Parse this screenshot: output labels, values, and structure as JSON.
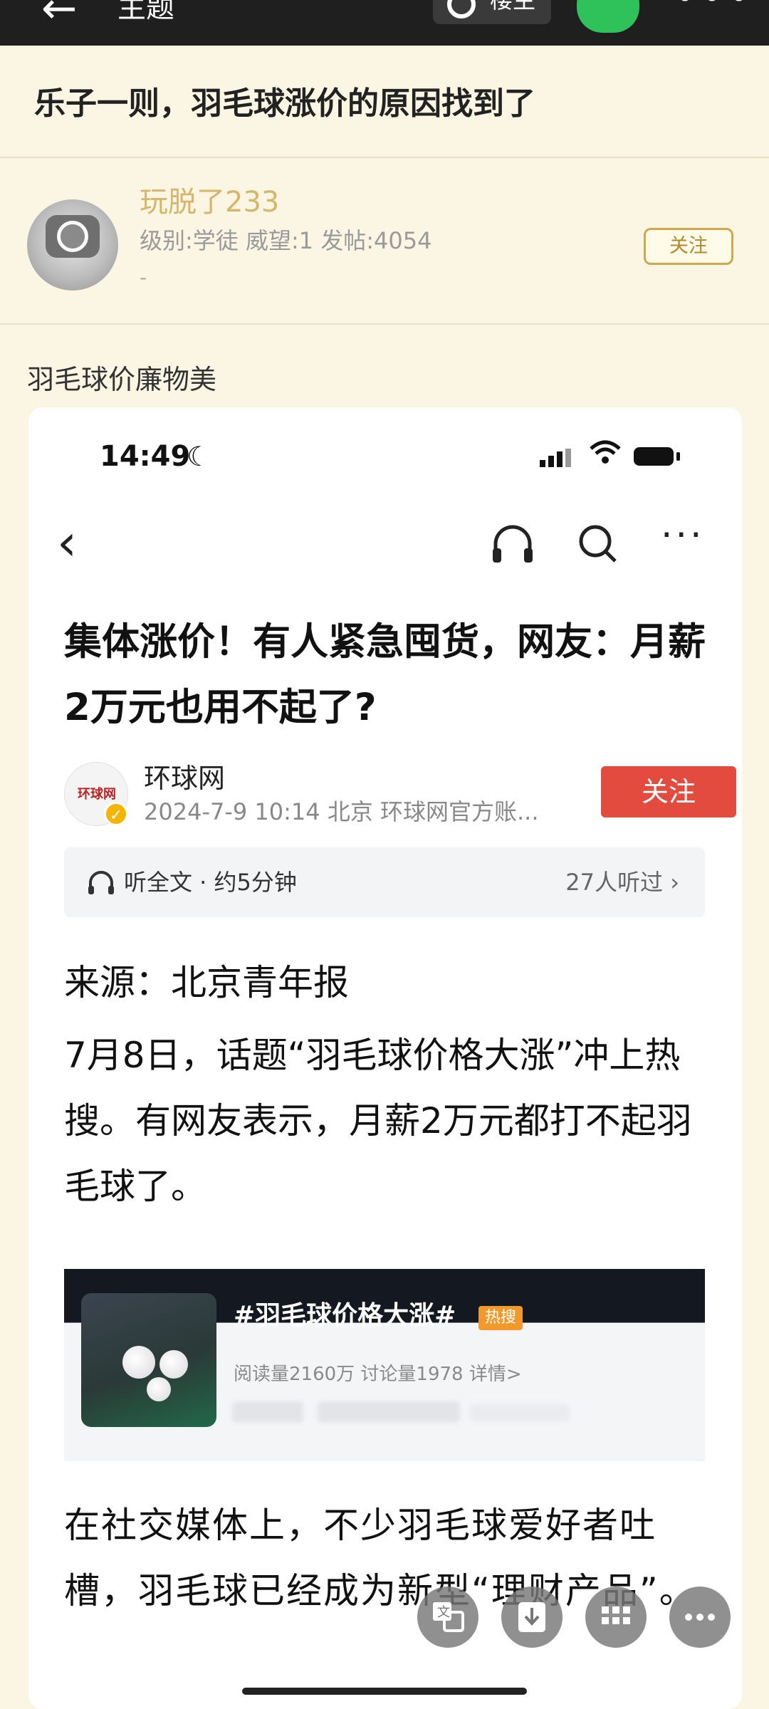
{
  "topbar": {
    "back_icon": "arrow-left-icon",
    "title": "主题",
    "op_label": "楼主",
    "share_icon": "wechat-icon",
    "more_icon": "more-horizontal-icon"
  },
  "thread": {
    "title": "乐子一则，羽毛球涨价的原因找到了"
  },
  "user": {
    "name": "玩脱了233",
    "meta": "级别:学徒 威望:1 发帖:4054",
    "dash": "-",
    "follow_label": "关注"
  },
  "post": {
    "caption": "羽毛球价廉物美"
  },
  "screenshot": {
    "status": {
      "time": "14:49",
      "moon": "☾"
    },
    "nav": {
      "back": "‹",
      "more": "···"
    },
    "article": {
      "title": "集体涨价！有人紧急囤货，网友：月薪2万元也用不起了?",
      "source_logo_text": "环球网",
      "source_name": "环球网",
      "source_meta": "2024-7-9 10:14 北京 环球网官方账...",
      "follow_label": "关注",
      "listen_text": "听全文 · 约5分钟",
      "listen_count": "27人听过 ›",
      "source_line": "来源：北京青年报",
      "para1": "7月8日，话题“羽毛球价格大涨”冲上热搜。有网友表示，月薪2万元都打不起羽毛球了。",
      "topic": {
        "title": "#羽毛球价格大涨#",
        "badge": "热搜",
        "stats": "阅读量2160万  讨论量1978  详情>"
      },
      "para2": "在社交媒体上，不少羽毛球爱好者吐槽，羽毛球已经成为新型“理财产品”。"
    }
  },
  "fabs": [
    "translate-icon",
    "download-icon",
    "grid-icon",
    "more-icon"
  ],
  "colors": {
    "topbar": "#1f1f1f",
    "page_bg": "#faf6e3",
    "username": "#d6b66a",
    "follow_border": "#cda84f",
    "article_follow": "#e24b3e",
    "wechat_green": "#2fc25b"
  }
}
